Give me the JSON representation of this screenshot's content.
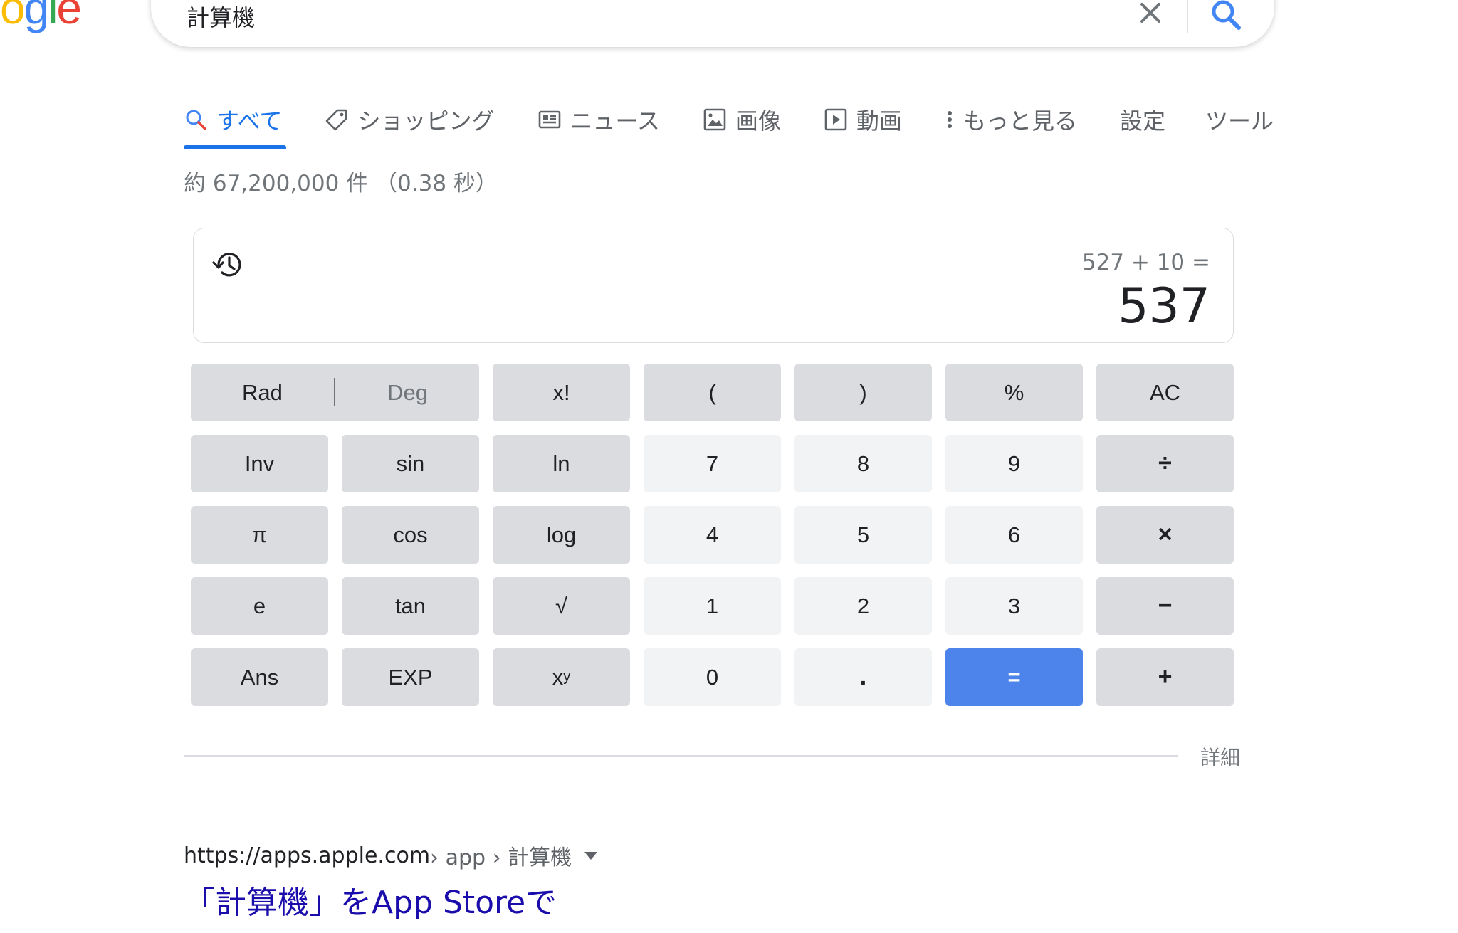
{
  "logo": {
    "text": "ogle"
  },
  "search": {
    "query": "計算機"
  },
  "tabs": [
    {
      "label": "すべて",
      "icon": "search-icon"
    },
    {
      "label": "ショッピング",
      "icon": "tag-icon"
    },
    {
      "label": "ニュース",
      "icon": "news-icon"
    },
    {
      "label": "画像",
      "icon": "image-icon"
    },
    {
      "label": "動画",
      "icon": "video-icon"
    },
    {
      "label": "もっと見る",
      "icon": "more-vert-icon"
    },
    {
      "label": "設定"
    },
    {
      "label": "ツール"
    }
  ],
  "stats": "約 67,200,000 件 （0.38 秒）",
  "calculator": {
    "expression": "527 + 10 =",
    "result": "537",
    "rad_label": "Rad",
    "deg_label": "Deg",
    "keys": {
      "fact": "x!",
      "lparen": "(",
      "rparen": ")",
      "percent": "%",
      "ac": "AC",
      "inv": "Inv",
      "sin": "sin",
      "ln": "ln",
      "k7": "7",
      "k8": "8",
      "k9": "9",
      "divide": "÷",
      "pi": "π",
      "cos": "cos",
      "log": "log",
      "k4": "4",
      "k5": "5",
      "k6": "6",
      "multiply": "×",
      "e": "e",
      "tan": "tan",
      "sqrt": "√",
      "k1": "1",
      "k2": "2",
      "k3": "3",
      "minus": "−",
      "ans": "Ans",
      "exp": "EXP",
      "pow_base": "x",
      "pow_exp": "y",
      "k0": "0",
      "dot": ".",
      "equals": "=",
      "plus": "+"
    },
    "detail": "詳細"
  },
  "result": {
    "site": "https://apps.apple.com",
    "path": " › app › 計算機",
    "title": "「計算機」をApp Storeで"
  },
  "colors": {
    "accent": "#1a73e8",
    "equals_key": "#4d84eb",
    "link": "#1a0dab"
  }
}
